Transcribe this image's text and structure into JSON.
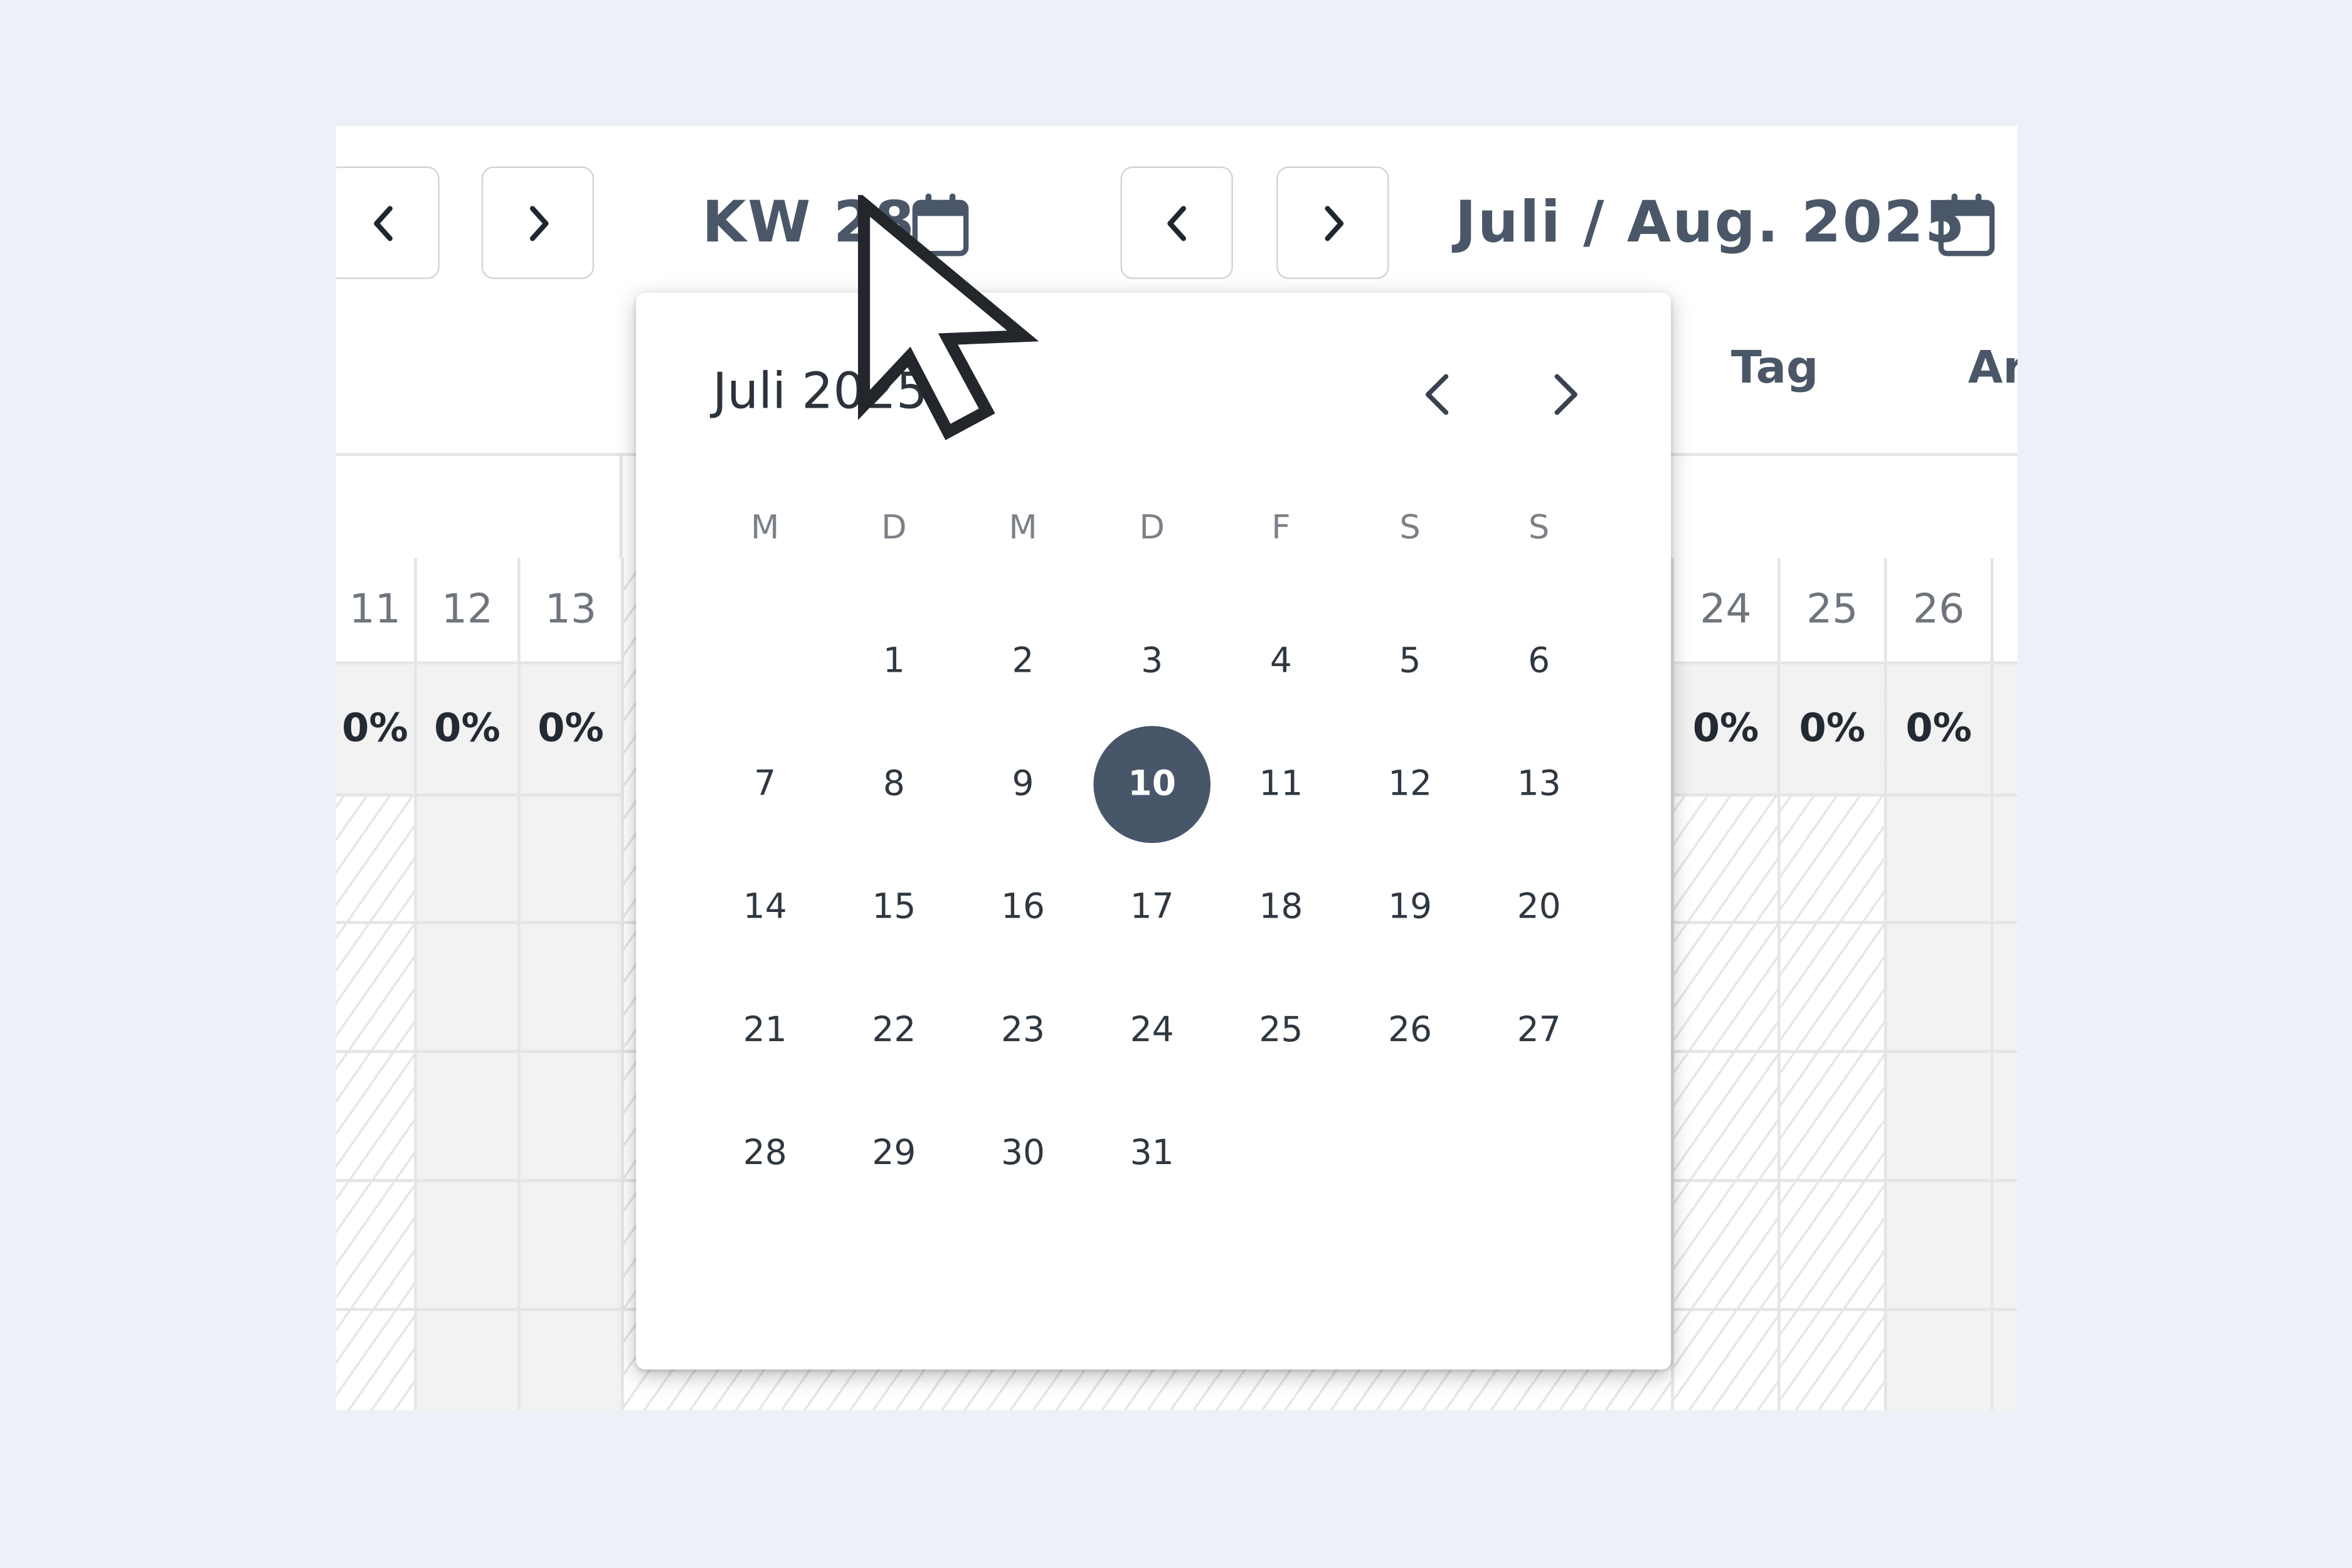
{
  "toolbar": {
    "week_label": "KW 28",
    "month_label": "Juli / Aug. 2025"
  },
  "header": {
    "columns": [
      "Tag",
      "Ar"
    ]
  },
  "timeline": {
    "left_days": [
      {
        "day": "11",
        "percent": "0%"
      },
      {
        "day": "12",
        "percent": "0%"
      },
      {
        "day": "13",
        "percent": "0%"
      }
    ],
    "right_days": [
      {
        "day": "24",
        "percent": "0%"
      },
      {
        "day": "25",
        "percent": "0%"
      },
      {
        "day": "26",
        "percent": "0%"
      }
    ]
  },
  "datepicker": {
    "title": "Juli 2025",
    "weekdays": [
      "M",
      "D",
      "M",
      "D",
      "F",
      "S",
      "S"
    ],
    "weeks": [
      [
        "",
        "1",
        "2",
        "3",
        "4",
        "5",
        "6"
      ],
      [
        "7",
        "8",
        "9",
        "10",
        "11",
        "12",
        "13"
      ],
      [
        "14",
        "15",
        "16",
        "17",
        "18",
        "19",
        "20"
      ],
      [
        "21",
        "22",
        "23",
        "24",
        "25",
        "26",
        "27"
      ],
      [
        "28",
        "29",
        "30",
        "31",
        "",
        "",
        ""
      ]
    ],
    "selected": "10",
    "selected_color": "#48566a"
  },
  "icons": [
    "chevron-left-icon",
    "chevron-right-icon",
    "calendar-icon",
    "mouse-cursor-icon"
  ]
}
